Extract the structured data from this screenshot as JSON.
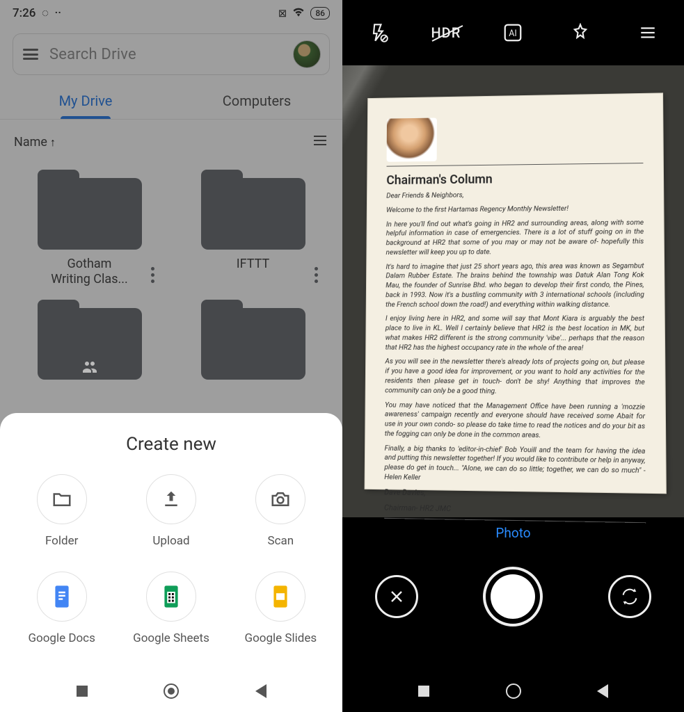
{
  "statusbar": {
    "time": "7:26",
    "battery": "86"
  },
  "search": {
    "placeholder": "Search Drive"
  },
  "tabs": {
    "drive": "My Drive",
    "computers": "Computers"
  },
  "sort": {
    "label": "Name",
    "direction": "↑"
  },
  "folders": [
    {
      "name": "Gotham\nWriting Clas..."
    },
    {
      "name": "IFTTT"
    },
    {
      "name": ""
    },
    {
      "name": ""
    }
  ],
  "sheet": {
    "title": "Create new",
    "options": [
      {
        "key": "folder",
        "label": "Folder"
      },
      {
        "key": "upload",
        "label": "Upload"
      },
      {
        "key": "scan",
        "label": "Scan"
      },
      {
        "key": "docs",
        "label": "Google Docs"
      },
      {
        "key": "sheets",
        "label": "Google Sheets"
      },
      {
        "key": "slides",
        "label": "Google Slides"
      }
    ]
  },
  "camera": {
    "hdr": "HDR",
    "mode": "Photo",
    "document": {
      "title": "Chairman's Column",
      "greeting": "Dear Friends & Neighbors,",
      "p1": "Welcome to the first Hartamas Regency Monthly Newsletter!",
      "p2": "In here you'll find out what's going in HR2 and surrounding areas, along with some helpful information in case of emergencies. There is a lot of stuff going on in the background at HR2 that some of you may or may not be aware of- hopefully this newsletter will keep you up to date.",
      "p3": "It's hard to imagine that just 25 short years ago, this area was known as Segambut Dalam Rubber Estate. The brains behind the township was Datuk Alan Tong Kok Mau, the founder of Sunrise Bhd. who began to develop their first condo, the Pines, back in 1993. Now it's a bustling community with 3 international schools (including the French school down the road!) and everything within walking distance.",
      "p4": "I enjoy living here in HR2, and some will say that Mont Kiara is arguably the best place to live in KL. Well I certainly believe that HR2 is the best location in MK, but what makes HR2 different is the strong community 'vibe'... perhaps that the reason that HR2 has the highest occupancy rate in the whole of the area!",
      "p5": "As you will see in the newsletter there's already lots of projects going on, but please if you have a good idea for improvement, or you want to hold any activities for the residents then please get in touch- don't be shy! Anything that improves the community can only be a good thing.",
      "p6": "You may have noticed that the Management Office have been running a 'mozzie awareness' campaign recently and everyone should have received some Abait for use in your own condo- so please do take time to read the notices and do your bit as the fogging can only be done in the common areas.",
      "p7": "Finally, a big thanks to 'editor-in-chief' Bob Youill and the team for having the idea and putting this newsletter together! If you would like to contribute or help in anyway, please do get in touch... \"Alone, we can do so little; together, we can do so much\" - Helen Keller",
      "sig1": "Dave Davies,",
      "sig2": "Chairman- HR2 JMC"
    }
  }
}
